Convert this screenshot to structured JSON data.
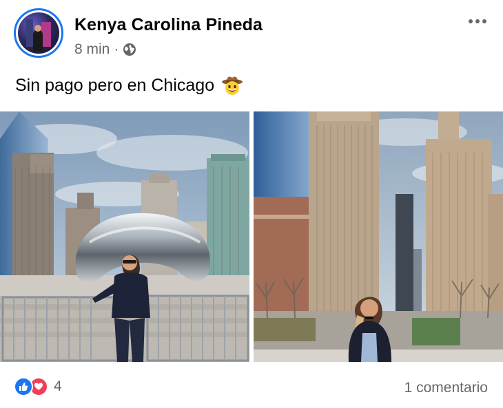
{
  "post": {
    "author": "Kenya Carolina Pineda",
    "time": "8 min",
    "separator": "·",
    "audience_icon": "globe-icon",
    "more_icon": "more-options-icon",
    "caption": "Sin pago pero en Chicago",
    "caption_emoji": "cowboy-hat-face-icon"
  },
  "photos": [
    {
      "name": "photo-cloud-gate",
      "description_icon": "photo"
    },
    {
      "name": "photo-michigan-ave",
      "description_icon": "photo"
    }
  ],
  "footer": {
    "reaction_icons": [
      "like-icon",
      "love-icon"
    ],
    "reaction_count": "4",
    "comments": "1 comentario"
  },
  "colors": {
    "accent": "#1877f2",
    "love": "#f33e58",
    "muted_text": "#65676b"
  }
}
